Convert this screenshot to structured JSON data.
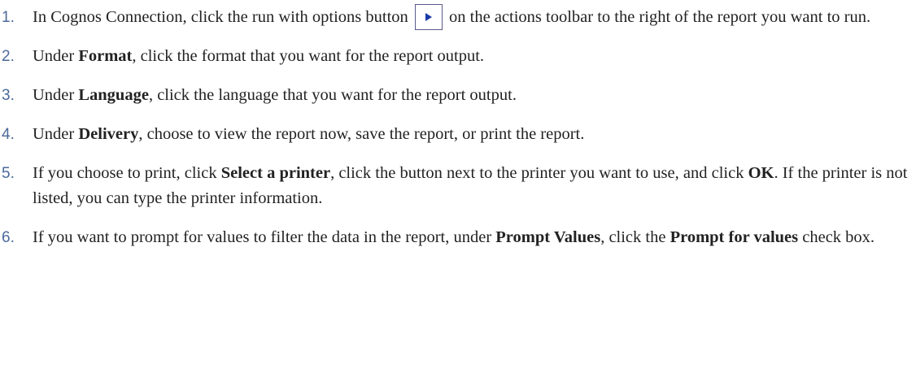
{
  "steps": [
    {
      "num": "1.",
      "before": "In Cognos Connection, click the run with options button",
      "icon": "run-with-options-icon",
      "after": "on the actions toolbar to the right of the report you want to run."
    },
    {
      "num": "2.",
      "pre": "Under ",
      "bold": "Format",
      "post": ", click the format that you want for the report output."
    },
    {
      "num": "3.",
      "pre": "Under ",
      "bold": "Language",
      "post": ", click the language that you want for the report output."
    },
    {
      "num": "4.",
      "pre": "Under ",
      "bold": "Delivery",
      "post": ", choose to view the report now, save the report, or print the report."
    },
    {
      "num": "5.",
      "pre": "If you choose to print, click ",
      "bold1": "Select a printer",
      "mid": ", click the button next to the printer you want to use, and click ",
      "bold2": "OK",
      "post": ". If the printer is not listed, you can type the printer information."
    },
    {
      "num": "6.",
      "pre": "If you want to prompt for values to filter the data in the report, under ",
      "bold1": "Prompt Values",
      "mid": ", click the ",
      "bold2": "Prompt for values",
      "post": " check box."
    }
  ],
  "colors": {
    "number": "#4a6a9a",
    "text": "#222222",
    "icon_fill": "#1a3aa8",
    "icon_border": "#5a5a8a"
  }
}
